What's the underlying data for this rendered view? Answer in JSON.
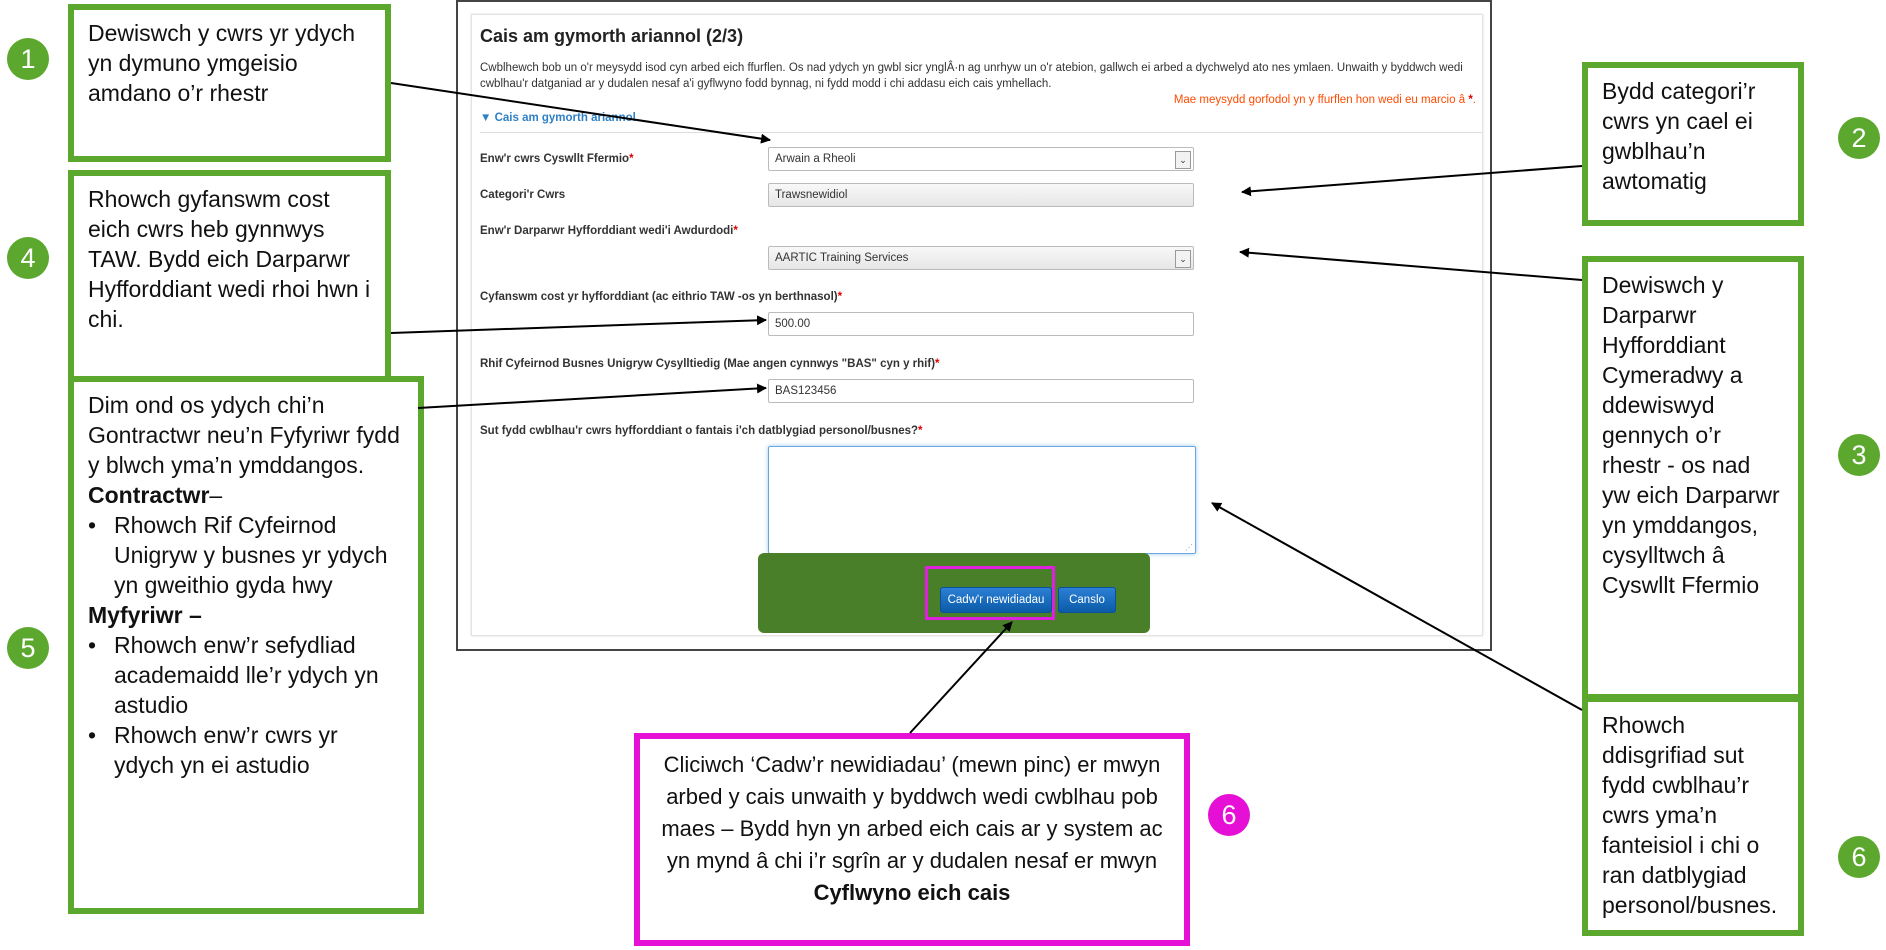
{
  "form": {
    "title": "Cais am gymorth ariannol (2/3)",
    "intro": "Cwblhewch bob un o'r meysydd isod cyn arbed eich ffurflen. Os nad ydych yn gwbl sicr ynglÂ·n ag unrhyw un o'r atebion, gallwch ei arbed a dychwelyd ato nes ymlaen. Unwaith y byddwch wedi cwblhau'r datganiad ar y dudalen nesaf a'i gyflwyno fodd bynnag, ni fydd modd i chi addasu eich cais ymhellach.",
    "required_note": "Mae meysydd gorfodol yn y ffurflen hon wedi eu marcio â",
    "required_star": "*",
    "section_label": "Cais am gymorth ariannol",
    "fields": {
      "course_name": {
        "label": "Enw'r cwrs Cyswllt Ffermio",
        "value": "Arwain a Rheoli"
      },
      "course_category": {
        "label": "Categori'r Cwrs",
        "value": "Trawsnewidiol"
      },
      "provider": {
        "label": "Enw'r Darparwr Hyfforddiant wedi'i Awdurdodi",
        "value": "AARTIC Training Services"
      },
      "total_cost": {
        "label": "Cyfanswm cost yr hyfforddiant (ac eithrio TAW -os yn berthnasol)",
        "value": "500.00"
      },
      "business_ref": {
        "label": "Rhif Cyfeirnod Busnes Unigryw Cysylltiedig (Mae angen cynnwys \"BAS\" cyn y rhif)",
        "value": "BAS123456"
      },
      "benefit": {
        "label": "Sut fydd cwblhau'r cwrs hyfforddiant o fantais i'ch datblygiad personol/busnes?",
        "value": ""
      }
    },
    "buttons": {
      "save": "Cadw'r newidiadau",
      "cancel": "Canslo"
    }
  },
  "callouts": {
    "c1": {
      "number": "1",
      "text": "Dewiswch y cwrs yr ydych yn dymuno ymgeisio amdano o’r rhestr"
    },
    "c2": {
      "number": "2",
      "text": "Bydd categori’r cwrs yn cael ei gwblhau’n awtomatig"
    },
    "c3": {
      "number": "3",
      "text": "Dewiswch y Darparwr Hyfforddiant Cymeradwy a ddewiswyd gennych o’r rhestr -  os nad yw eich Darparwr yn ymddangos, cysylltwch â Cyswllt Ffermio"
    },
    "c4": {
      "number": "4",
      "text": "Rhowch gyfanswm cost eich cwrs heb gynnwys TAW. Bydd eich Darparwr Hyfforddiant wedi rhoi hwn i chi."
    },
    "c5": {
      "number": "5",
      "intro": "Dim ond os ydych chi’n Gontractwr neu’n Fyfyriwr fydd y blwch yma’n ymddangos.",
      "contractor_heading": "Contractwr",
      "contractor_dash": "–",
      "contractor_items": [
        "Rhowch Rif Cyfeirnod Unigryw y busnes yr ydych yn gweithio gyda hwy"
      ],
      "student_heading": "Myfyriwr –",
      "student_items": [
        "Rhowch enw’r sefydliad academaidd lle’r ydych yn astudio",
        "Rhowch enw’r cwrs yr ydych yn ei astudio"
      ],
      "bullet": "•"
    },
    "c6a": {
      "number": "6",
      "text_before": "Cliciwch ‘Cadw’r newidiadau’ (mewn pinc) er mwyn arbed y cais unwaith y byddwch wedi cwblhau pob maes – Bydd hyn yn arbed eich cais ar y system ac yn mynd â chi i’r sgrîn ar y dudalen nesaf er mwyn",
      "text_bold": "Cyflwyno eich cais"
    },
    "c6b": {
      "number": "6",
      "text": "Rhowch ddisgrifiad sut fydd cwblhau’r cwrs yma’n fanteisiol i chi o ran datblygiad personol/busnes."
    }
  },
  "colors": {
    "callout_green": "#5ca82e",
    "callout_pink": "#e60fd6",
    "button_blue": "#0b5ba8",
    "action_bar_green": "#4a7f2a",
    "required_red": "#ff4b00"
  }
}
